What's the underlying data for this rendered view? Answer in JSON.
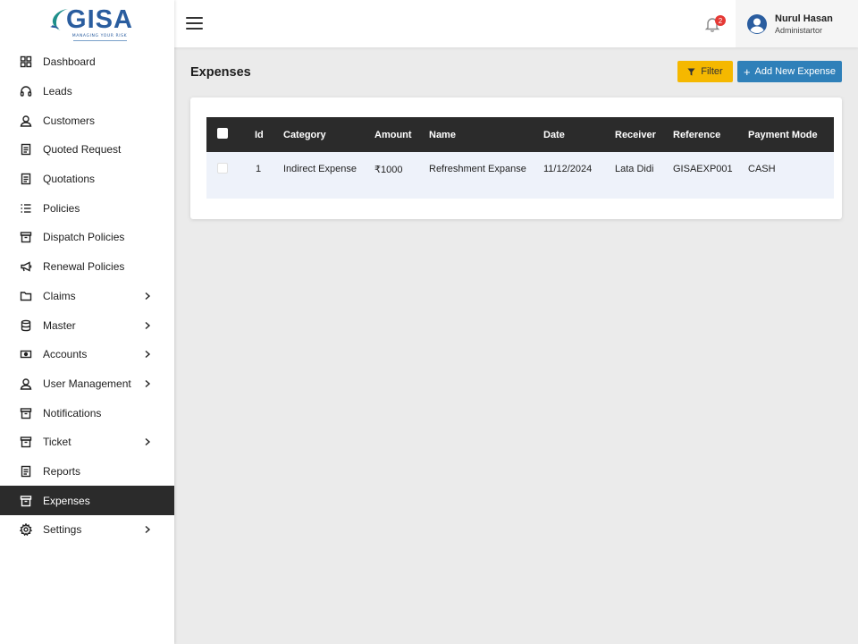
{
  "brand": {
    "logo_text": "GISA",
    "tagline": "MANAGING YOUR RISK"
  },
  "sidebar": {
    "items": [
      {
        "label": "Dashboard",
        "icon": "grid-icon"
      },
      {
        "label": "Leads",
        "icon": "headset-icon"
      },
      {
        "label": "Customers",
        "icon": "user-icon"
      },
      {
        "label": "Quoted Request",
        "icon": "document-icon"
      },
      {
        "label": "Quotations",
        "icon": "document-icon"
      },
      {
        "label": "Policies",
        "icon": "list-icon"
      },
      {
        "label": "Dispatch Policies",
        "icon": "archive-icon"
      },
      {
        "label": "Renewal Policies",
        "icon": "megaphone-icon"
      },
      {
        "label": "Claims",
        "icon": "folder-icon"
      },
      {
        "label": "Master",
        "icon": "database-icon"
      },
      {
        "label": "Accounts",
        "icon": "cash-icon"
      },
      {
        "label": "User Management",
        "icon": "user-icon"
      },
      {
        "label": "Notifications",
        "icon": "archive-icon"
      },
      {
        "label": "Ticket",
        "icon": "archive-icon"
      },
      {
        "label": "Reports",
        "icon": "document-icon"
      },
      {
        "label": "Expenses",
        "icon": "archive-icon"
      },
      {
        "label": "Settings",
        "icon": "gear-icon"
      }
    ],
    "active": "Expenses"
  },
  "topbar": {
    "notification_count": "2",
    "user_name": "Nurul Hasan",
    "user_role": "Administartor"
  },
  "main": {
    "title": "Expenses",
    "filter_label": "Filter",
    "add_label": "Add New Expense"
  },
  "table": {
    "columns": [
      "Id",
      "Category",
      "Amount",
      "Name",
      "Date",
      "Receiver",
      "Reference",
      "Payment Mode"
    ],
    "rows": [
      {
        "id": "1",
        "category": "Indirect Expense",
        "amount": "₹1000",
        "name": "Refreshment Expanse",
        "date": "11/12/2024",
        "receiver": "Lata Didi",
        "reference": "GISAEXP001",
        "payment_mode": "CASH"
      }
    ]
  }
}
